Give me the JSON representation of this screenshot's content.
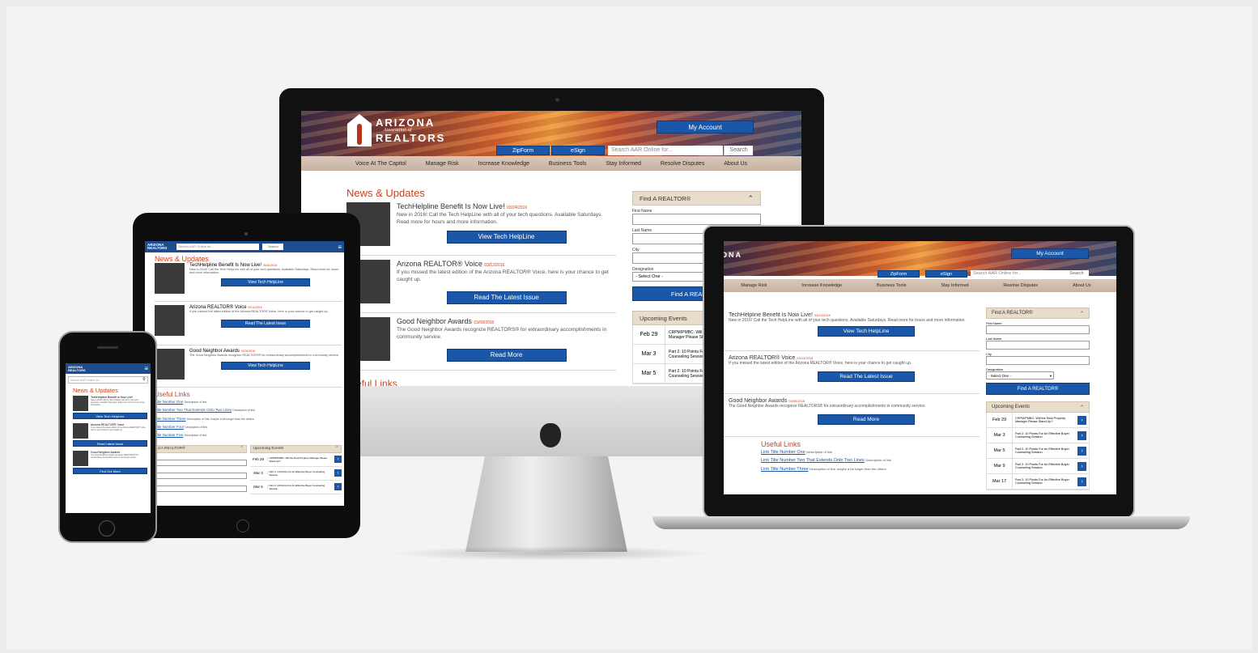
{
  "brand": {
    "name_line1": "ARIZONA",
    "name_mid": "Association of",
    "name_line2": "REALTORS"
  },
  "header": {
    "my_account": "My Account",
    "zipform": "ZipForm",
    "esign": "eSign",
    "search_placeholder": "Search AAR Online for...",
    "search_button": "Search"
  },
  "nav": [
    "Voice At The Capitol",
    "Manage Risk",
    "Increase Knowledge",
    "Business Tools",
    "Stay Informed",
    "Resolve Disputes",
    "About Us"
  ],
  "news": {
    "title": "News & Updates",
    "items": [
      {
        "headline": "TechHelpline Benefit Is Now Live!",
        "date": "03/24/2016",
        "body": "New in 2016! Call the Tech HelpLine with all of your tech questions. Available Saturdays. Read more for hours and more information.",
        "button": "View Tech HelpLine"
      },
      {
        "headline": "Arizona REALTOR® Voice",
        "date": "03/12/2016",
        "body": "If you missed the latest edition of the Arizona REALTOR® Voice, here is your chance to get caught up.",
        "button": "Read The Latest Issue"
      },
      {
        "headline": "Good Neighbor Awards",
        "date": "03/09/2016",
        "body": "The Good Neighbor Awards recognize REALTORS® for extraordinary accomplishments in community service.",
        "button": "Read More"
      }
    ]
  },
  "useful_links": {
    "title": "Useful Links",
    "imac_fragment": "eful Links",
    "tablet_links": [
      {
        "text": "Title Number One",
        "desc": "Description of link"
      },
      {
        "text": "Title Number Two That Extends Onto Two Lines",
        "desc": "Description of link"
      },
      {
        "text": "Title Number Three",
        "desc": "Description of link, maybe a bit longer than the others"
      },
      {
        "text": "Title Number Four",
        "desc": "Description of link"
      },
      {
        "text": "Title Number Five",
        "desc": "Description of link"
      }
    ],
    "laptop_links": [
      {
        "text": "Link Title Number One",
        "desc": "Description of link"
      },
      {
        "text": "Link Title Number Two That Extends Onto Two Lines",
        "desc": "Description of link"
      },
      {
        "text": "Link Title Number Three",
        "desc": "Description of link, maybe a bit longer than the others"
      }
    ]
  },
  "find_realtor": {
    "title": "Find A REALTOR®",
    "tablet_fragment": "d A REALTOR®",
    "first_name": "First Name",
    "last_name": "Last Name",
    "city": "City",
    "designation": "Designation",
    "select_default": "- Select One -",
    "button": "Find A REALTOR®"
  },
  "events": {
    "title": "Upcoming Events",
    "items": [
      {
        "date": "Feb 29",
        "text": "CRPM/PMBC: Will the Real Property Manager Please Stand Up?"
      },
      {
        "date": "Mar 3",
        "text": "Part 2: 10 Points For An Effective Buyer Counseling Session"
      },
      {
        "date": "Mar 5",
        "text": "Part 2: 10 Points For An Effective Buyer Counseling Session"
      },
      {
        "date": "Mar 9",
        "text": "Part 2: 10 Points For An Effective Buyer Counseling Session"
      },
      {
        "date": "Mar 17",
        "text": "Part 2: 10 Points For An Effective Buyer Counseling Session"
      }
    ]
  },
  "mobile": {
    "tablet_news_items": [
      {
        "headline": "TechHelpline Benefit Is Now Live!",
        "date": "03/24/2016",
        "body": "New in 2016! Call the Tech HelpLine with all of your tech questions. Available Saturdays. Read more for hours and more information.",
        "button": "View Tech HelpLine"
      },
      {
        "headline": "Arizona REALTOR® Voice",
        "date": "03/12/2016",
        "body": "If you missed the latest edition of the Arizona REALTOR® Voice, here is your chance to get caught up.",
        "button": "Read The Latest Issue"
      },
      {
        "headline": "Good Neighbor Awards",
        "date": "03/09/2016",
        "body": "The Good Neighbor Awards recognize REALTORS® for extraordinary accomplishments in community service.",
        "button": "View Tech HelpLine"
      }
    ],
    "phone_news_items": [
      {
        "headline": "TechHelpline Benefit Is Now Live!",
        "body": "New in 2016! Call the Tech Helpline with all of your tech questions. Available Saturdays. Read more for hours and more information.",
        "button": "View Tech HelpLine"
      },
      {
        "headline": "Arizona REALTOR® Voice",
        "body": "If you missed the latest edition of the Arizona REALTOR® Voice, here is your chance to get caught up.",
        "button": "Read Latest Issue"
      },
      {
        "headline": "Good Neighbor Awards",
        "body": "The Good Neighbor Awards recognize REALTORS® for extraordinary accomplishments in community service.",
        "button": "Find Out More"
      }
    ]
  },
  "colors": {
    "brand_blue": "#1a57a8",
    "accent_orange": "#c9431f",
    "panel_tan": "#e8dccb"
  }
}
